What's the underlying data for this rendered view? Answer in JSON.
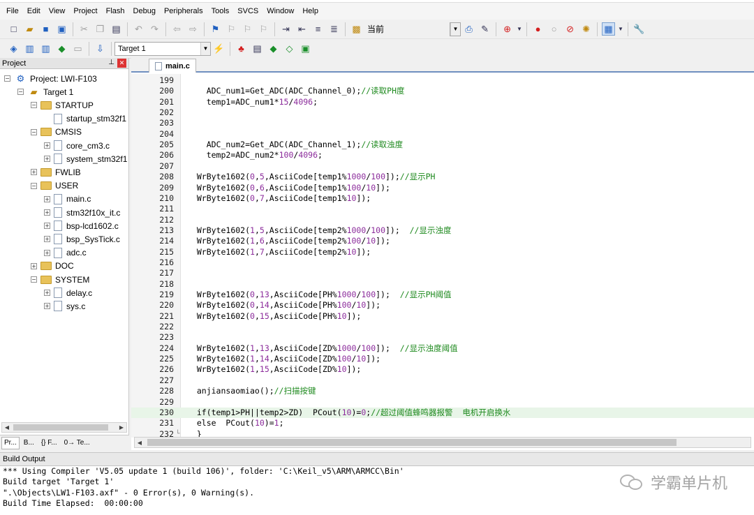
{
  "menu": [
    "File",
    "Edit",
    "View",
    "Project",
    "Flash",
    "Debug",
    "Peripherals",
    "Tools",
    "SVCS",
    "Window",
    "Help"
  ],
  "toolbar1": {
    "find_label": "当前"
  },
  "toolbar2": {
    "target": "Target 1"
  },
  "project": {
    "header": "Project",
    "tree": [
      {
        "label": "Project: LWI-F103",
        "indent": 0,
        "toggle": "−",
        "icon": "project-icon"
      },
      {
        "label": "Target 1",
        "indent": 1,
        "toggle": "−",
        "icon": "target-icon"
      },
      {
        "label": "STARTUP",
        "indent": 2,
        "toggle": "−",
        "icon": "folder-icon"
      },
      {
        "label": "startup_stm32f1",
        "indent": 3,
        "toggle": "",
        "icon": "file-icon"
      },
      {
        "label": "CMSIS",
        "indent": 2,
        "toggle": "−",
        "icon": "folder-icon"
      },
      {
        "label": "core_cm3.c",
        "indent": 3,
        "toggle": "+",
        "icon": "file-icon"
      },
      {
        "label": "system_stm32f1",
        "indent": 3,
        "toggle": "+",
        "icon": "file-icon"
      },
      {
        "label": "FWLIB",
        "indent": 2,
        "toggle": "+",
        "icon": "folder-icon"
      },
      {
        "label": "USER",
        "indent": 2,
        "toggle": "−",
        "icon": "folder-icon"
      },
      {
        "label": "main.c",
        "indent": 3,
        "toggle": "+",
        "icon": "file-icon"
      },
      {
        "label": "stm32f10x_it.c",
        "indent": 3,
        "toggle": "+",
        "icon": "file-icon"
      },
      {
        "label": "bsp-lcd1602.c",
        "indent": 3,
        "toggle": "+",
        "icon": "file-icon"
      },
      {
        "label": "bsp_SysTick.c",
        "indent": 3,
        "toggle": "+",
        "icon": "file-icon"
      },
      {
        "label": "adc.c",
        "indent": 3,
        "toggle": "+",
        "icon": "file-icon"
      },
      {
        "label": "DOC",
        "indent": 2,
        "toggle": "+",
        "icon": "folder-icon"
      },
      {
        "label": "SYSTEM",
        "indent": 2,
        "toggle": "−",
        "icon": "folder-icon"
      },
      {
        "label": "delay.c",
        "indent": 3,
        "toggle": "+",
        "icon": "file-icon"
      },
      {
        "label": "sys.c",
        "indent": 3,
        "toggle": "+",
        "icon": "file-icon"
      }
    ],
    "tabs": [
      "Pr...",
      "B...",
      "{} F...",
      "0→ Te..."
    ]
  },
  "editor": {
    "tab": "main.c",
    "lines": [
      {
        "n": "199",
        "t": ""
      },
      {
        "n": "200",
        "t": "    ADC_num1=Get_ADC(ADC_Channel_0);",
        "c": "//读取PH度"
      },
      {
        "n": "201",
        "t": "    temp1=ADC_num1*15/4096;"
      },
      {
        "n": "202",
        "t": ""
      },
      {
        "n": "203",
        "t": ""
      },
      {
        "n": "204",
        "t": ""
      },
      {
        "n": "205",
        "t": "    ADC_num2=Get_ADC(ADC_Channel_1);",
        "c": "//读取浊度"
      },
      {
        "n": "206",
        "t": "    temp2=ADC_num2*100/4096;"
      },
      {
        "n": "207",
        "t": ""
      },
      {
        "n": "208",
        "t": "  WrByte1602(0,5,AsciiCode[temp1%1000/100]);",
        "c": "//显示PH"
      },
      {
        "n": "209",
        "t": "  WrByte1602(0,6,AsciiCode[temp1%100/10]);"
      },
      {
        "n": "210",
        "t": "  WrByte1602(0,7,AsciiCode[temp1%10]);"
      },
      {
        "n": "211",
        "t": ""
      },
      {
        "n": "212",
        "t": ""
      },
      {
        "n": "213",
        "t": "  WrByte1602(1,5,AsciiCode[temp2%1000/100]);  ",
        "c": "//显示浊度"
      },
      {
        "n": "214",
        "t": "  WrByte1602(1,6,AsciiCode[temp2%100/10]);"
      },
      {
        "n": "215",
        "t": "  WrByte1602(1,7,AsciiCode[temp2%10]);"
      },
      {
        "n": "216",
        "t": ""
      },
      {
        "n": "217",
        "t": ""
      },
      {
        "n": "218",
        "t": ""
      },
      {
        "n": "219",
        "t": "  WrByte1602(0,13,AsciiCode[PH%1000/100]);  ",
        "c": "//显示PH阈值"
      },
      {
        "n": "220",
        "t": "  WrByte1602(0,14,AsciiCode[PH%100/10]);"
      },
      {
        "n": "221",
        "t": "  WrByte1602(0,15,AsciiCode[PH%10]);"
      },
      {
        "n": "222",
        "t": ""
      },
      {
        "n": "223",
        "t": ""
      },
      {
        "n": "224",
        "t": "  WrByte1602(1,13,AsciiCode[ZD%1000/100]);  ",
        "c": "//显示浊度阈值"
      },
      {
        "n": "225",
        "t": "  WrByte1602(1,14,AsciiCode[ZD%100/10]);"
      },
      {
        "n": "226",
        "t": "  WrByte1602(1,15,AsciiCode[ZD%10]);"
      },
      {
        "n": "227",
        "t": ""
      },
      {
        "n": "228",
        "t": "  anjiansaomiao();",
        "c": "//扫描按键"
      },
      {
        "n": "229",
        "t": ""
      },
      {
        "n": "230",
        "t": "  if(temp1>PH||temp2>ZD)  PCout(10)=0;",
        "c": "//超过阈值蜂鸣器报警  电机开启换水",
        "hl": true
      },
      {
        "n": "231",
        "t": "  else  PCout(10)=1;"
      },
      {
        "n": "232",
        "t": "  }"
      }
    ]
  },
  "build": {
    "title": "Build Output",
    "lines": [
      "*** Using Compiler 'V5.05 update 1 (build 106)', folder: 'C:\\Keil_v5\\ARM\\ARMCC\\Bin'",
      "Build target 'Target 1'",
      "\".\\Objects\\LW1-F103.axf\" - 0 Error(s), 0 Warning(s).",
      "Build Time Elapsed:  00:00:00"
    ]
  },
  "watermark": "学霸单片机",
  "colors": {
    "comment": "#1f8a1f",
    "number": "#8b2b9b",
    "highlight": "#e8f5e8",
    "tab_underline": "#6f8fbf"
  }
}
